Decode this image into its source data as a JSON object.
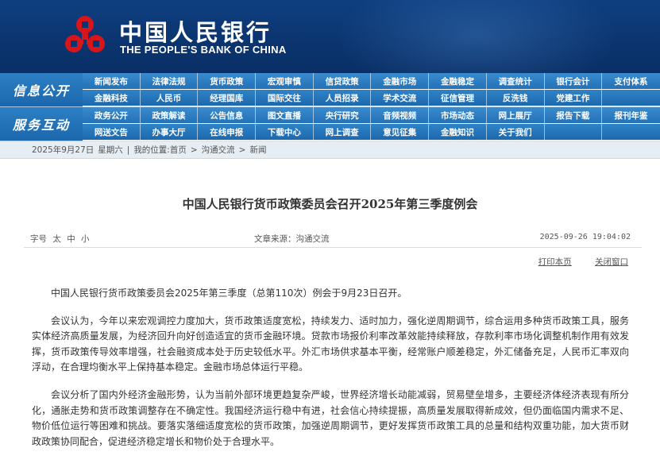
{
  "header": {
    "title_cn": "中国人民银行",
    "title_en": "THE PEOPLE'S BANK OF CHINA",
    "logo_icon": "pboc-emblem-icon",
    "colors": {
      "banner": "#0b3570",
      "emblem_red": "#d7161c",
      "nav_blue": "#2371b6"
    }
  },
  "nav": {
    "groups": [
      {
        "label": "信息公开",
        "rows": [
          [
            "新闻发布",
            "法律法规",
            "货币政策",
            "宏观审慎",
            "信贷政策",
            "金融市场",
            "金融稳定",
            "调查统计",
            "银行会计",
            "支付体系"
          ],
          [
            "金融科技",
            "人民币",
            "经理国库",
            "国际交往",
            "人员招录",
            "学术交流",
            "征信管理",
            "反洗钱",
            "党建工作",
            ""
          ]
        ]
      },
      {
        "label": "服务互动",
        "rows": [
          [
            "政务公开",
            "政策解读",
            "公告信息",
            "图文直播",
            "央行研究",
            "音频视频",
            "市场动态",
            "网上展厅",
            "报告下载",
            "报刊年鉴"
          ],
          [
            "网送文告",
            "办事大厅",
            "在线申报",
            "下载中心",
            "网上调查",
            "意见征集",
            "金融知识",
            "关于我们",
            "",
            ""
          ]
        ]
      }
    ]
  },
  "breadcrumb": {
    "date": "2025年9月27日",
    "weekday": "星期六",
    "prefix": "我的位置:",
    "home": "首页",
    "section": "沟通交流",
    "page": "新闻",
    "sep": ">"
  },
  "article": {
    "title": "中国人民银行货币政策委员会召开2025年第三季度例会",
    "font_size_label": "字号",
    "font_sizes": [
      "太",
      "中",
      "小"
    ],
    "source_label": "文章来源：",
    "source": "沟通交流",
    "datetime": "2025-09-26 19:04:02",
    "print_label": "打印本页",
    "close_label": "关闭窗口",
    "paragraphs": [
      "中国人民银行货币政策委员会2025年第三季度（总第110次）例会于9月23日召开。",
      "会议认为，今年以来宏观调控力度加大，货币政策适度宽松，持续发力、适时加力，强化逆周期调节，综合运用多种货币政策工具，服务实体经济高质量发展，为经济回升向好创造适宜的货币金融环境。贷款市场报价利率改革效能持续释放，存款利率市场化调整机制作用有效发挥，货币政策传导效率增强，社会融资成本处于历史较低水平。外汇市场供求基本平衡，经常账户顺差稳定，外汇储备充足，人民币汇率双向浮动，在合理均衡水平上保持基本稳定。金融市场总体运行平稳。",
      "会议分析了国内外经济金融形势，认为当前外部环境更趋复杂严峻，世界经济增长动能减弱，贸易壁垒增多，主要经济体经济表现有所分化，通胀走势和货币政策调整存在不确定性。我国经济运行稳中有进，社会信心持续提振，高质量发展取得新成效，但仍面临国内需求不足、物价低位运行等困难和挑战。要落实落细适度宽松的货币政策，加强逆周期调节，更好发挥货币政策工具的总量和结构双重功能，加大货币财政政策协同配合，促进经济稳定增长和物价处于合理水平。"
    ]
  }
}
